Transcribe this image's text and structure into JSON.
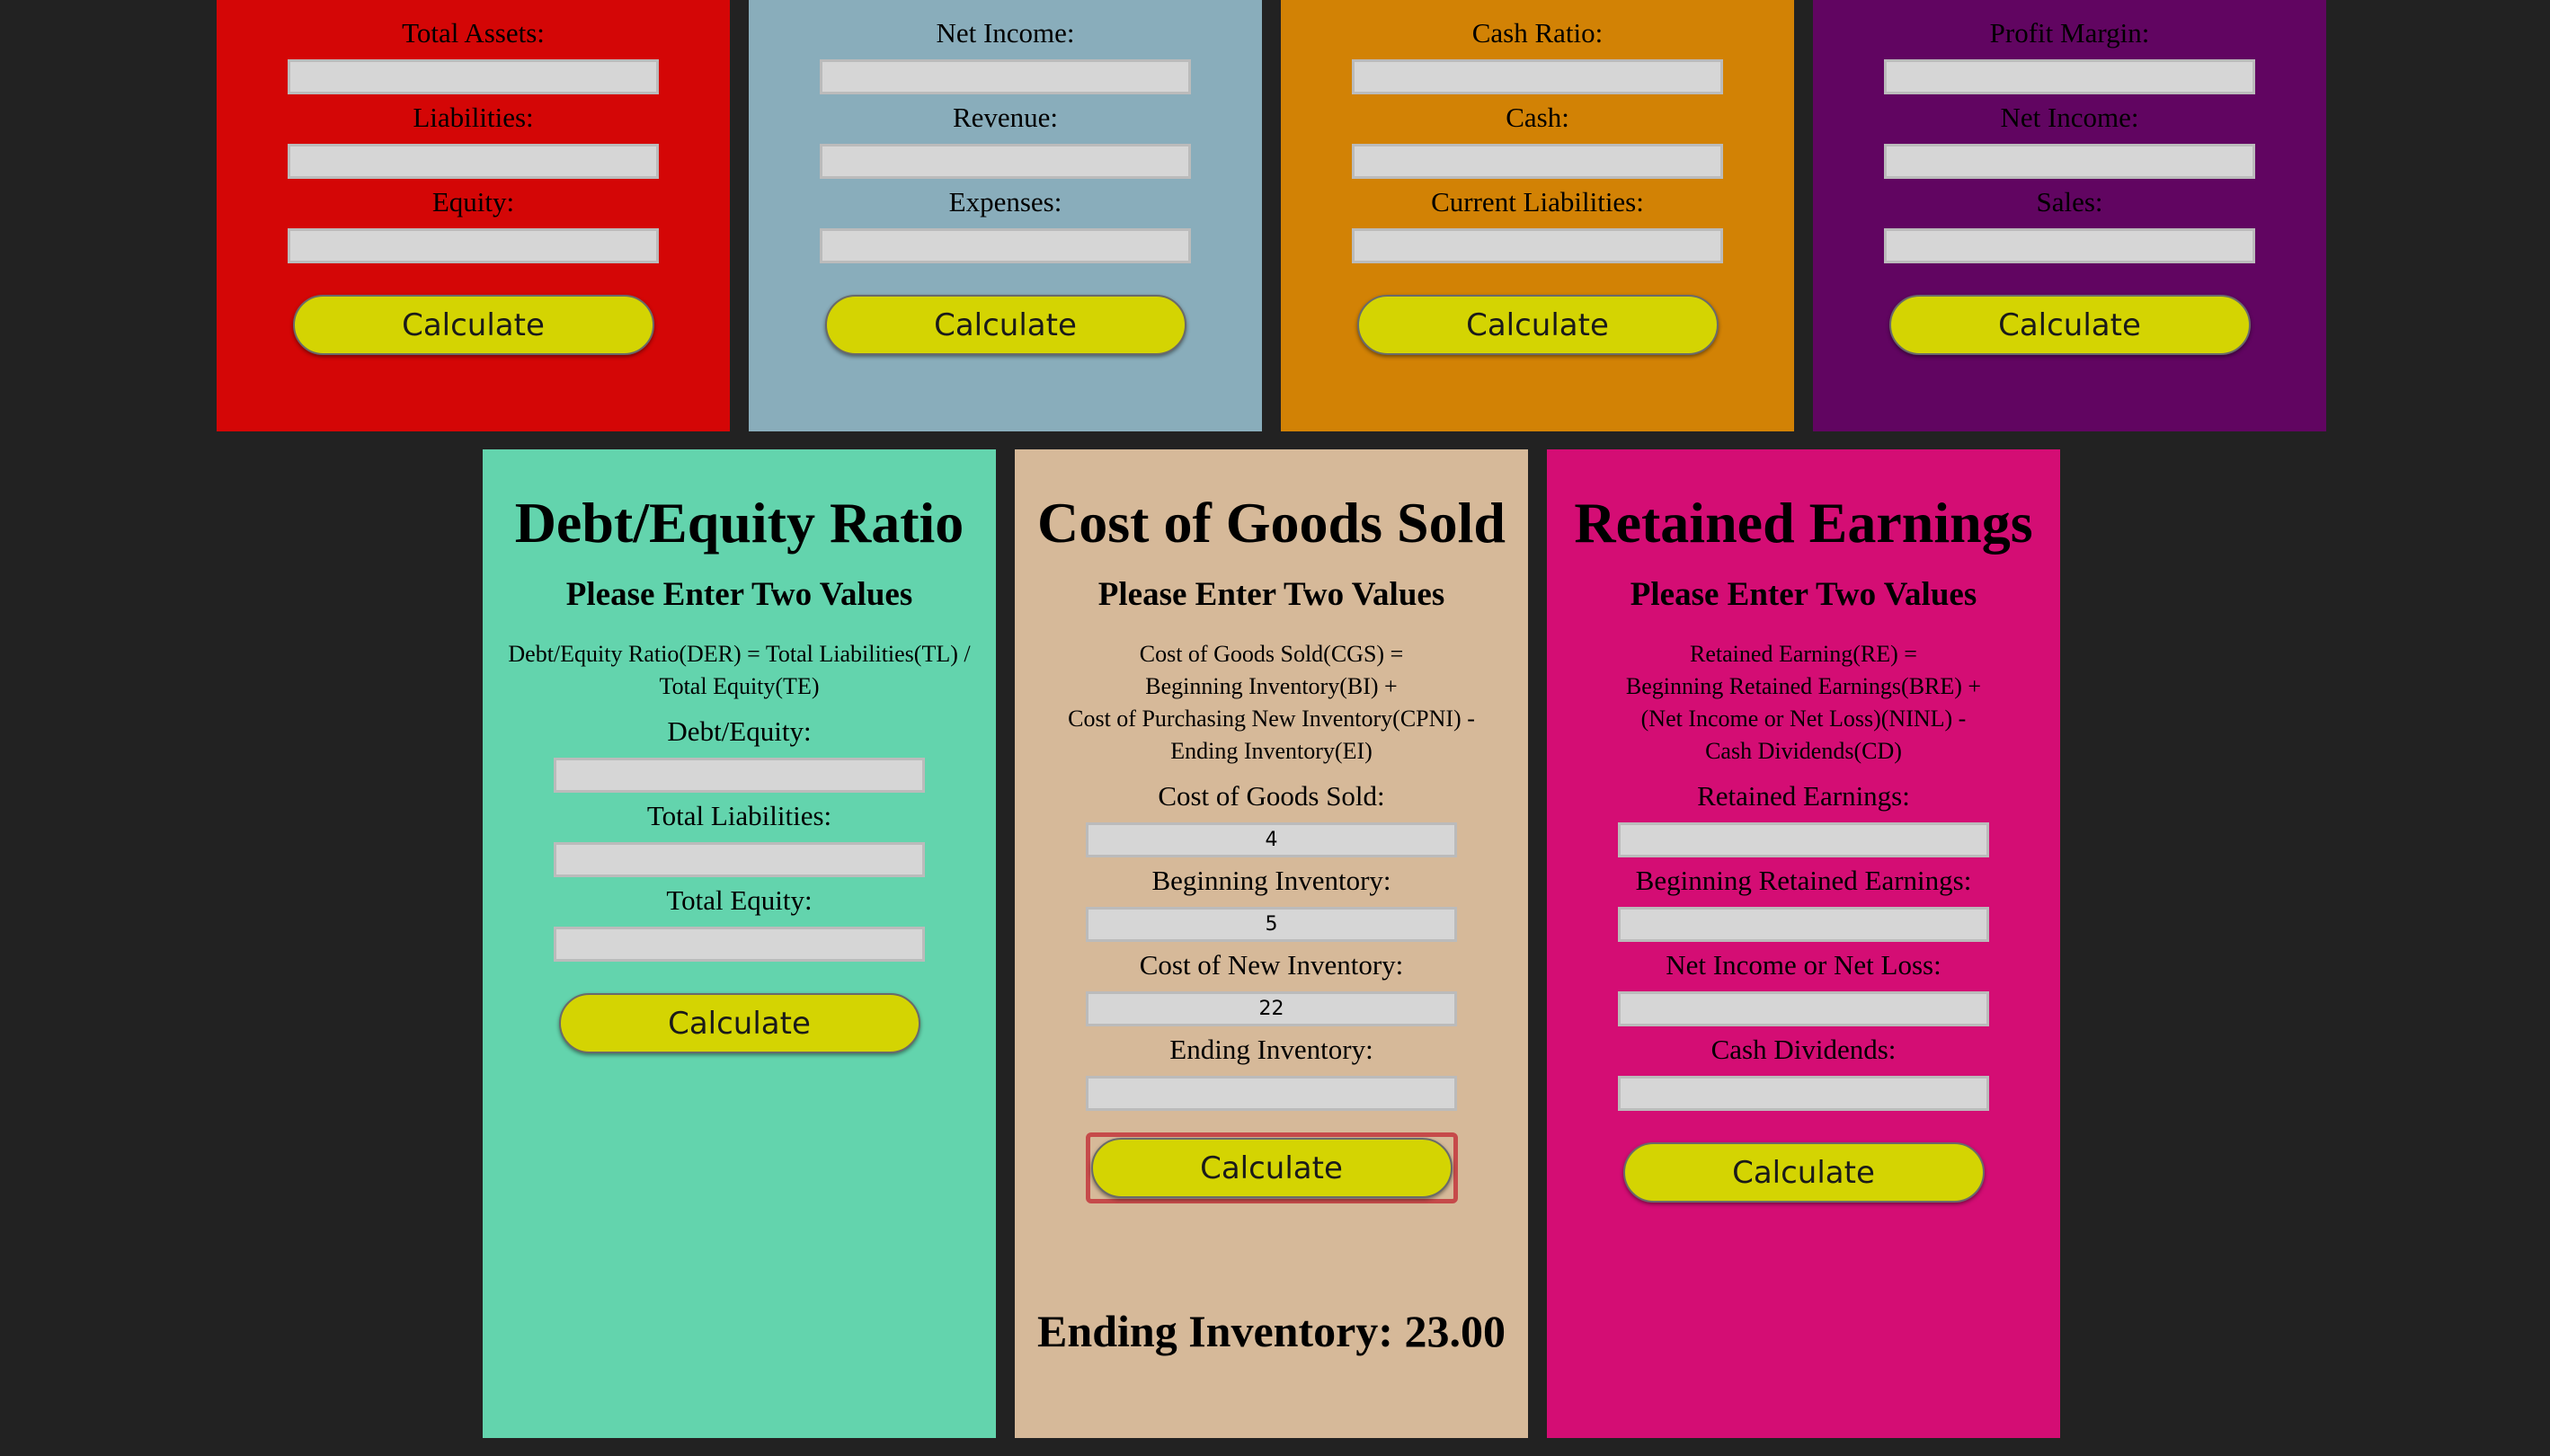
{
  "colors": {
    "background": "#222222",
    "card_red": "#d40606",
    "card_blue": "#89adbb",
    "card_orange": "#d28205",
    "card_purple": "#610561",
    "card_green": "#63d4ad",
    "card_tan": "#d6b999",
    "card_pink": "#d40d74",
    "button": "#d4d402",
    "input": "#d6d6d6"
  },
  "top_cards": [
    {
      "fields": [
        {
          "label": "Total Assets:",
          "value": ""
        },
        {
          "label": "Liabilities:",
          "value": ""
        },
        {
          "label": "Equity:",
          "value": ""
        }
      ],
      "button": "Calculate"
    },
    {
      "fields": [
        {
          "label": "Net Income:",
          "value": ""
        },
        {
          "label": "Revenue:",
          "value": ""
        },
        {
          "label": "Expenses:",
          "value": ""
        }
      ],
      "button": "Calculate"
    },
    {
      "fields": [
        {
          "label": "Cash Ratio:",
          "value": ""
        },
        {
          "label": "Cash:",
          "value": ""
        },
        {
          "label": "Current Liabilities:",
          "value": ""
        }
      ],
      "button": "Calculate"
    },
    {
      "fields": [
        {
          "label": "Profit Margin:",
          "value": ""
        },
        {
          "label": "Net Income:",
          "value": ""
        },
        {
          "label": "Sales:",
          "value": ""
        }
      ],
      "button": "Calculate"
    }
  ],
  "debt_equity": {
    "title": "Debt/Equity Ratio",
    "subtitle": "Please Enter Two Values",
    "formula": [
      "Debt/Equity Ratio(DER) = Total Liabilities(TL) /",
      "Total Equity(TE)"
    ],
    "fields": [
      {
        "label": "Debt/Equity:",
        "value": ""
      },
      {
        "label": "Total Liabilities:",
        "value": ""
      },
      {
        "label": "Total Equity:",
        "value": ""
      }
    ],
    "button": "Calculate"
  },
  "cogs": {
    "title": "Cost of Goods Sold",
    "subtitle": "Please Enter Two Values",
    "formula": [
      "Cost of Goods Sold(CGS) =",
      "Beginning Inventory(BI) +",
      "Cost of Purchasing New Inventory(CPNI) -",
      "Ending Inventory(EI)"
    ],
    "fields": [
      {
        "label": "Cost of Goods Sold:",
        "value": "4"
      },
      {
        "label": "Beginning Inventory:",
        "value": "5"
      },
      {
        "label": "Cost of New Inventory:",
        "value": "22"
      },
      {
        "label": "Ending Inventory:",
        "value": ""
      }
    ],
    "button": "Calculate",
    "result": "Ending Inventory: 23.00"
  },
  "retained": {
    "title": "Retained Earnings",
    "subtitle": "Please Enter Two Values",
    "formula": [
      "Retained Earning(RE) =",
      "Beginning Retained Earnings(BRE) +",
      "(Net Income or Net Loss)(NINL) -",
      "Cash Dividends(CD)"
    ],
    "fields": [
      {
        "label": "Retained Earnings:",
        "value": ""
      },
      {
        "label": "Beginning Retained Earnings:",
        "value": ""
      },
      {
        "label": "Net Income or Net Loss:",
        "value": ""
      },
      {
        "label": "Cash Dividends:",
        "value": ""
      }
    ],
    "button": "Calculate"
  }
}
